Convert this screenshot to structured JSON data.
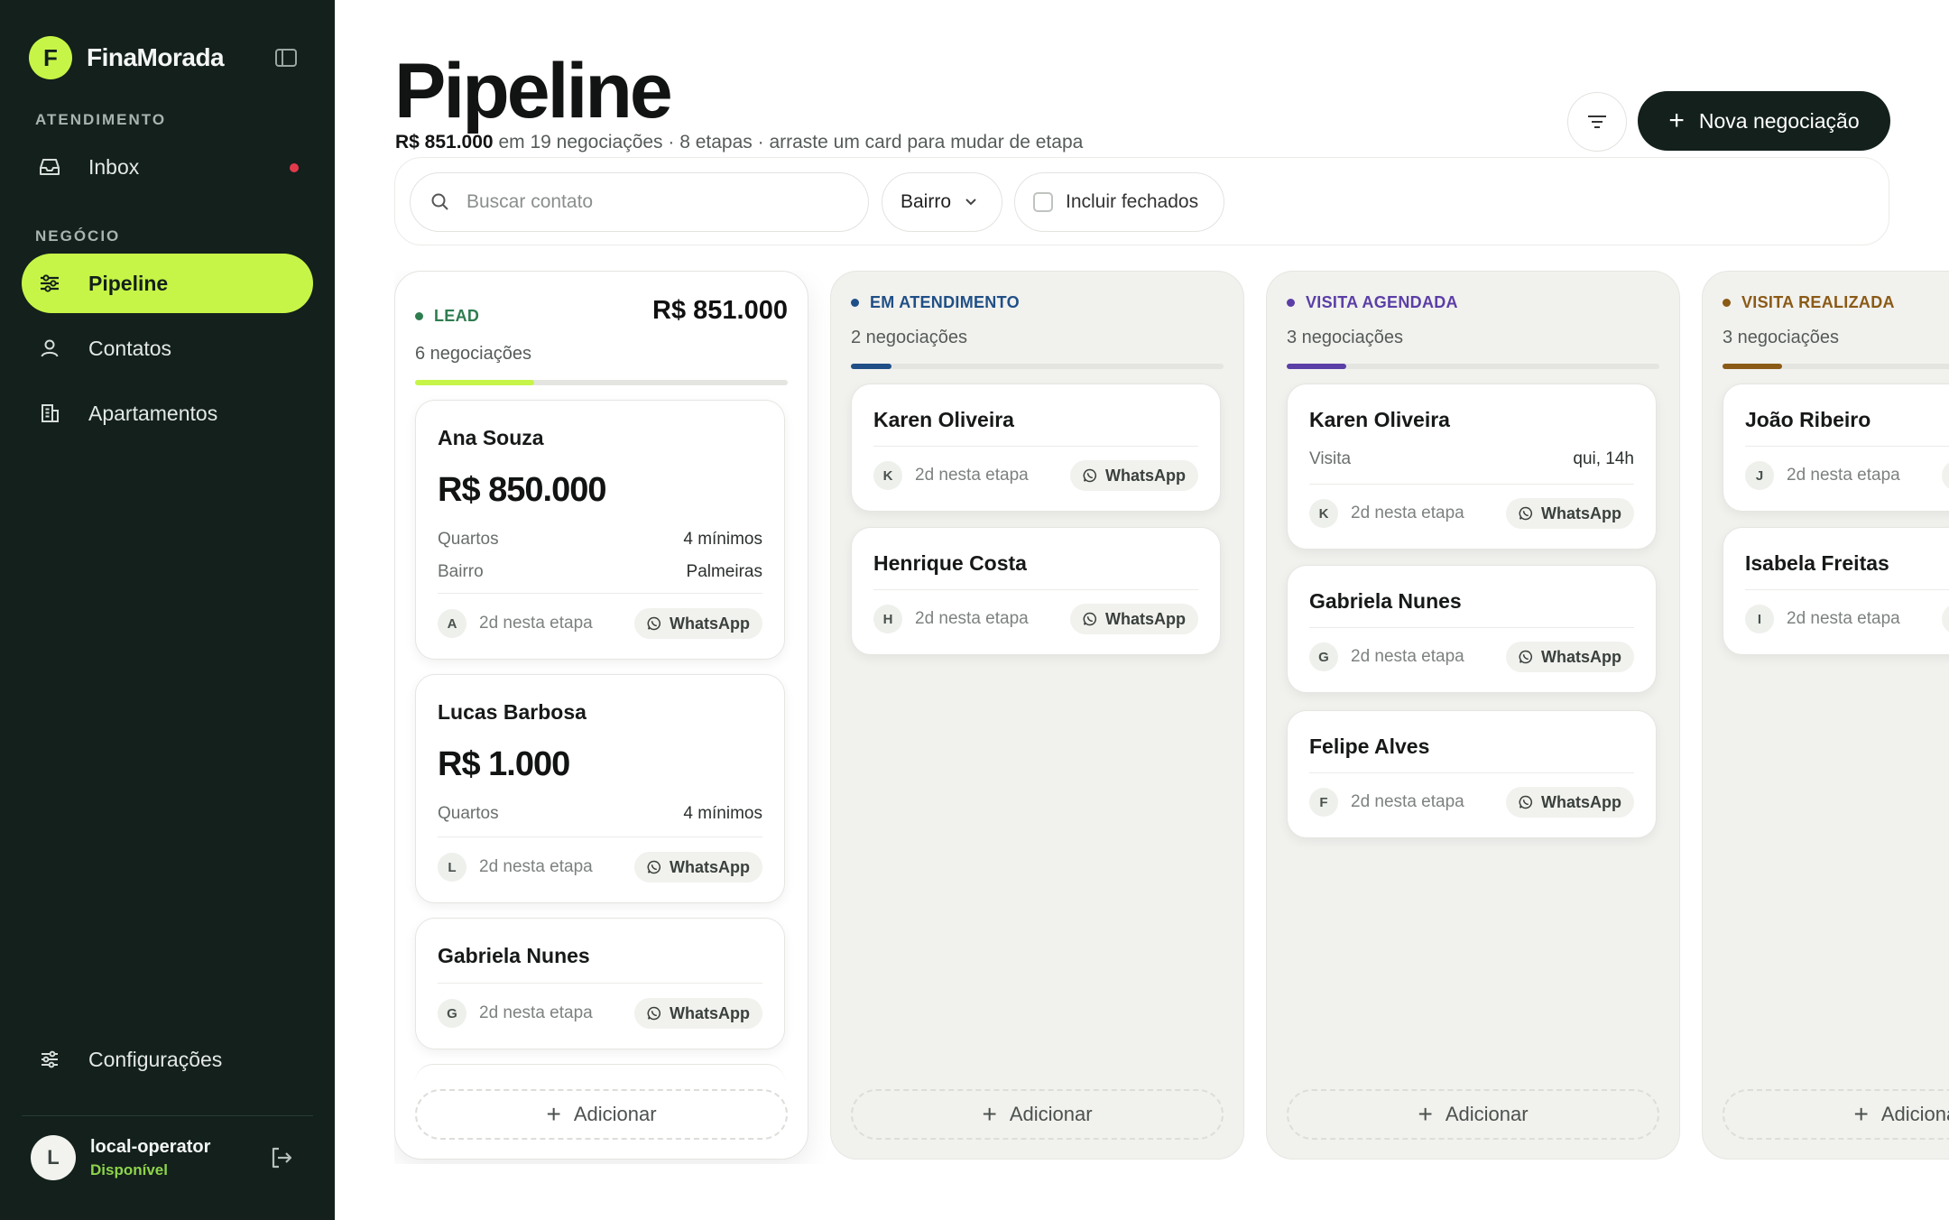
{
  "sidebar": {
    "brand_initial": "F",
    "brand_name": "FinaMorada",
    "section_atendimento": "ATENDIMENTO",
    "inbox_label": "Inbox",
    "section_negocio": "NEGÓCIO",
    "pipeline_label": "Pipeline",
    "contatos_label": "Contatos",
    "apartamentos_label": "Apartamentos",
    "config_label": "Configurações",
    "user_initial": "L",
    "user_name": "local-operator",
    "user_status": "Disponível"
  },
  "header": {
    "title": "Pipeline",
    "total": "R$ 851.000",
    "summary": "em 19 negociações · 8 etapas · arraste um card para mudar de etapa",
    "new_button": "Nova negociação"
  },
  "filters": {
    "search_placeholder": "Buscar contato",
    "bairro": "Bairro",
    "include_closed": "Incluir fechados"
  },
  "common": {
    "days": "2d nesta etapa",
    "whatsapp": "WhatsApp",
    "add": "Adicionar"
  },
  "colors": {
    "accent": "#c6f547",
    "lead": "#2e7d4f",
    "em_atendimento": "#1f4f86",
    "visita_agendada": "#5b3ea6",
    "visita_realizada": "#8a5a16"
  },
  "columns": [
    {
      "title": "LEAD",
      "total": "R$ 851.000",
      "count": "6 negociações",
      "progress": 0.32,
      "cards": [
        {
          "name": "Ana Souza",
          "value": "R$ 850.000",
          "initial": "A",
          "rows": [
            {
              "k": "Quartos",
              "v": "4 mínimos"
            },
            {
              "k": "Bairro",
              "v": "Palmeiras"
            }
          ]
        },
        {
          "name": "Lucas Barbosa",
          "value": "R$ 1.000",
          "initial": "L",
          "rows": [
            {
              "k": "Quartos",
              "v": "4 mínimos"
            }
          ]
        },
        {
          "name": "Gabriela Nunes",
          "initial": "G"
        }
      ]
    },
    {
      "title": "EM ATENDIMENTO",
      "count": "2 negociações",
      "progress": 0.11,
      "cards": [
        {
          "name": "Karen Oliveira",
          "initial": "K"
        },
        {
          "name": "Henrique Costa",
          "initial": "H"
        }
      ]
    },
    {
      "title": "VISITA AGENDADA",
      "count": "3 negociações",
      "progress": 0.16,
      "cards": [
        {
          "name": "Karen Oliveira",
          "initial": "K",
          "rows": [
            {
              "k": "Visita",
              "v": "qui, 14h"
            }
          ]
        },
        {
          "name": "Gabriela Nunes",
          "initial": "G"
        },
        {
          "name": "Felipe Alves",
          "initial": "F"
        }
      ]
    },
    {
      "title": "VISITA REALIZADA",
      "count": "3 negociações",
      "progress": 0.16,
      "cards": [
        {
          "name": "João Ribeiro",
          "initial": "J"
        },
        {
          "name": "Isabela Freitas",
          "initial": "I"
        }
      ]
    }
  ]
}
